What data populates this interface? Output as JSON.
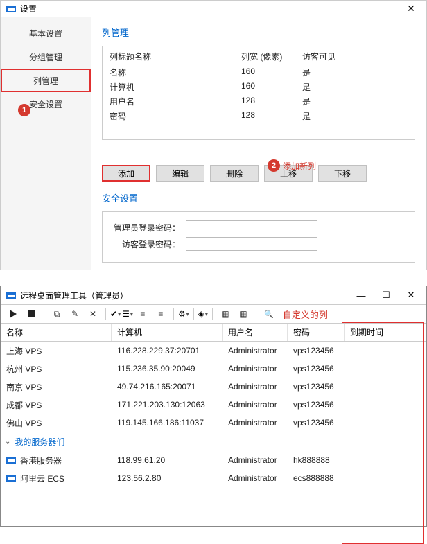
{
  "settings": {
    "title": "设置",
    "nav": {
      "basic": "基本设置",
      "group": "分组管理",
      "column": "列管理",
      "security": "安全设置"
    },
    "section_column": "列管理",
    "cols": {
      "hdr_name": "列标题名称",
      "hdr_width": "列宽 (像素)",
      "hdr_guest": "访客可见",
      "rows": [
        {
          "name": "名称",
          "width": "160",
          "guest": "是"
        },
        {
          "name": "计算机",
          "width": "160",
          "guest": "是"
        },
        {
          "name": "用户名",
          "width": "128",
          "guest": "是"
        },
        {
          "name": "密码",
          "width": "128",
          "guest": "是"
        }
      ]
    },
    "annot_add": "添加新列",
    "buttons": {
      "add": "添加",
      "edit": "编辑",
      "delete": "删除",
      "up": "上移",
      "down": "下移"
    },
    "section_security": "安全设置",
    "admin_pw_label": "管理员登录密码：",
    "guest_pw_label": "访客登录密码："
  },
  "behind": {
    "rows": [
      "上",
      "杭",
      "南",
      "成",
      "佛"
    ]
  },
  "badge": {
    "one": "1",
    "two": "2"
  },
  "main": {
    "title": "远程桌面管理工具（管理员）",
    "custom_col_label": "自定义的列",
    "grid": {
      "hdr_name": "名称",
      "hdr_comp": "计算机",
      "hdr_user": "用户名",
      "hdr_pass": "密码",
      "hdr_exp": "到期时间"
    },
    "rows": [
      {
        "name": "上海 VPS",
        "comp": "116.228.229.37:20701",
        "user": "Administrator",
        "pass": "vps123456"
      },
      {
        "name": "杭州 VPS",
        "comp": "115.236.35.90:20049",
        "user": "Administrator",
        "pass": "vps123456"
      },
      {
        "name": "南京 VPS",
        "comp": "49.74.216.165:20071",
        "user": "Administrator",
        "pass": "vps123456"
      },
      {
        "name": "成都 VPS",
        "comp": "171.221.203.130:12063",
        "user": "Administrator",
        "pass": "vps123456"
      },
      {
        "name": "佛山 VPS",
        "comp": "119.145.166.186:11037",
        "user": "Administrator",
        "pass": "vps123456"
      }
    ],
    "group_label": "我的服务器们",
    "group_rows": [
      {
        "name": "香港服务器",
        "comp": "118.99.61.20",
        "user": "Administrator",
        "pass": "hk888888"
      },
      {
        "name": "阿里云 ECS",
        "comp": "123.56.2.80",
        "user": "Administrator",
        "pass": "ecs888888"
      }
    ]
  }
}
